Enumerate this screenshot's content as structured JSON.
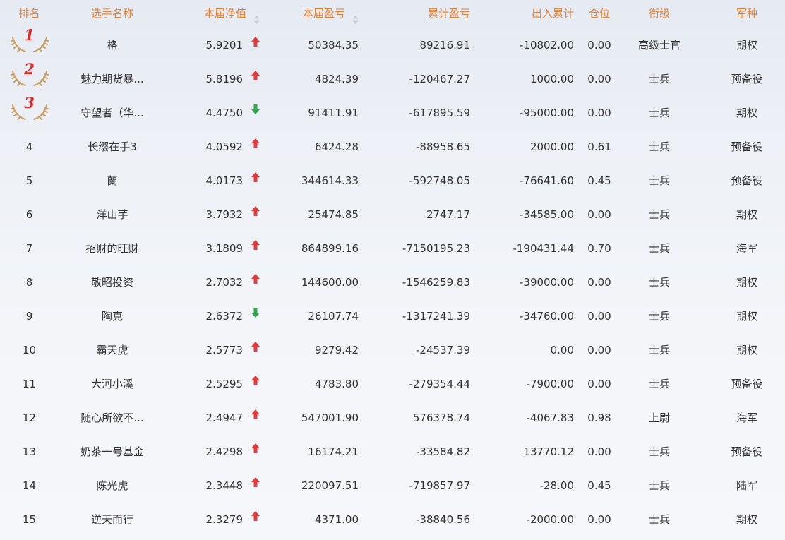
{
  "columns": {
    "rank": "排名",
    "name": "选手名称",
    "nav": "本届净值",
    "profit": "本届盈亏",
    "cum_profit": "累计盈亏",
    "flow": "出入累计",
    "position": "仓位",
    "military_rank": "衔级",
    "branch": "军种"
  },
  "colors": {
    "header": "#e0813a",
    "up": "#e23b3b",
    "down": "#2ea84a",
    "medal_num": "#e02a2a",
    "wing": "#c9a16a"
  },
  "rows": [
    {
      "rank": "1",
      "medal": true,
      "name": "格",
      "nav": "5.9201",
      "trend": "up",
      "profit": "50384.35",
      "cum_profit": "89216.91",
      "flow": "-10802.00",
      "position": "0.00",
      "military_rank": "高级士官",
      "branch": "期权"
    },
    {
      "rank": "2",
      "medal": true,
      "name": "魅力期货暴...",
      "nav": "5.8196",
      "trend": "up",
      "profit": "4824.39",
      "cum_profit": "-120467.27",
      "flow": "1000.00",
      "position": "0.00",
      "military_rank": "士兵",
      "branch": "预备役"
    },
    {
      "rank": "3",
      "medal": true,
      "name": "守望者（华...",
      "nav": "4.4750",
      "trend": "down",
      "profit": "91411.91",
      "cum_profit": "-617895.59",
      "flow": "-95000.00",
      "position": "0.00",
      "military_rank": "士兵",
      "branch": "期权"
    },
    {
      "rank": "4",
      "medal": false,
      "name": "长缨在手3",
      "nav": "4.0592",
      "trend": "up",
      "profit": "6424.28",
      "cum_profit": "-88958.65",
      "flow": "2000.00",
      "position": "0.61",
      "military_rank": "士兵",
      "branch": "预备役"
    },
    {
      "rank": "5",
      "medal": false,
      "name": "蘭",
      "nav": "4.0173",
      "trend": "up",
      "profit": "344614.33",
      "cum_profit": "-592748.05",
      "flow": "-76641.60",
      "position": "0.45",
      "military_rank": "士兵",
      "branch": "预备役"
    },
    {
      "rank": "6",
      "medal": false,
      "name": "洋山芋",
      "nav": "3.7932",
      "trend": "up",
      "profit": "25474.85",
      "cum_profit": "2747.17",
      "flow": "-34585.00",
      "position": "0.00",
      "military_rank": "士兵",
      "branch": "期权"
    },
    {
      "rank": "7",
      "medal": false,
      "name": "招财的旺财",
      "nav": "3.1809",
      "trend": "up",
      "profit": "864899.16",
      "cum_profit": "-7150195.23",
      "flow": "-190431.44",
      "position": "0.70",
      "military_rank": "士兵",
      "branch": "海军"
    },
    {
      "rank": "8",
      "medal": false,
      "name": "敬昭投资",
      "nav": "2.7032",
      "trend": "up",
      "profit": "144600.00",
      "cum_profit": "-1546259.83",
      "flow": "-39000.00",
      "position": "0.00",
      "military_rank": "士兵",
      "branch": "期权"
    },
    {
      "rank": "9",
      "medal": false,
      "name": "陶克",
      "nav": "2.6372",
      "trend": "down",
      "profit": "26107.74",
      "cum_profit": "-1317241.39",
      "flow": "-34760.00",
      "position": "0.00",
      "military_rank": "士兵",
      "branch": "期权"
    },
    {
      "rank": "10",
      "medal": false,
      "name": "霸天虎",
      "nav": "2.5773",
      "trend": "up",
      "profit": "9279.42",
      "cum_profit": "-24537.39",
      "flow": "0.00",
      "position": "0.00",
      "military_rank": "士兵",
      "branch": "期权"
    },
    {
      "rank": "11",
      "medal": false,
      "name": "大河小溪",
      "nav": "2.5295",
      "trend": "up",
      "profit": "4783.80",
      "cum_profit": "-279354.44",
      "flow": "-7900.00",
      "position": "0.00",
      "military_rank": "士兵",
      "branch": "预备役"
    },
    {
      "rank": "12",
      "medal": false,
      "name": "随心所欲不...",
      "nav": "2.4947",
      "trend": "up",
      "profit": "547001.90",
      "cum_profit": "576378.74",
      "flow": "-4067.83",
      "position": "0.98",
      "military_rank": "上尉",
      "branch": "海军"
    },
    {
      "rank": "13",
      "medal": false,
      "name": "奶茶一号基金",
      "nav": "2.4298",
      "trend": "up",
      "profit": "16174.21",
      "cum_profit": "-33584.82",
      "flow": "13770.12",
      "position": "0.00",
      "military_rank": "士兵",
      "branch": "预备役"
    },
    {
      "rank": "14",
      "medal": false,
      "name": "陈光虎",
      "nav": "2.3448",
      "trend": "up",
      "profit": "220097.51",
      "cum_profit": "-719857.97",
      "flow": "-28.00",
      "position": "0.45",
      "military_rank": "士兵",
      "branch": "陆军"
    },
    {
      "rank": "15",
      "medal": false,
      "name": "逆天而行",
      "nav": "2.3279",
      "trend": "up",
      "profit": "4371.00",
      "cum_profit": "-38840.56",
      "flow": "-2000.00",
      "position": "0.00",
      "military_rank": "士兵",
      "branch": "期权"
    }
  ]
}
